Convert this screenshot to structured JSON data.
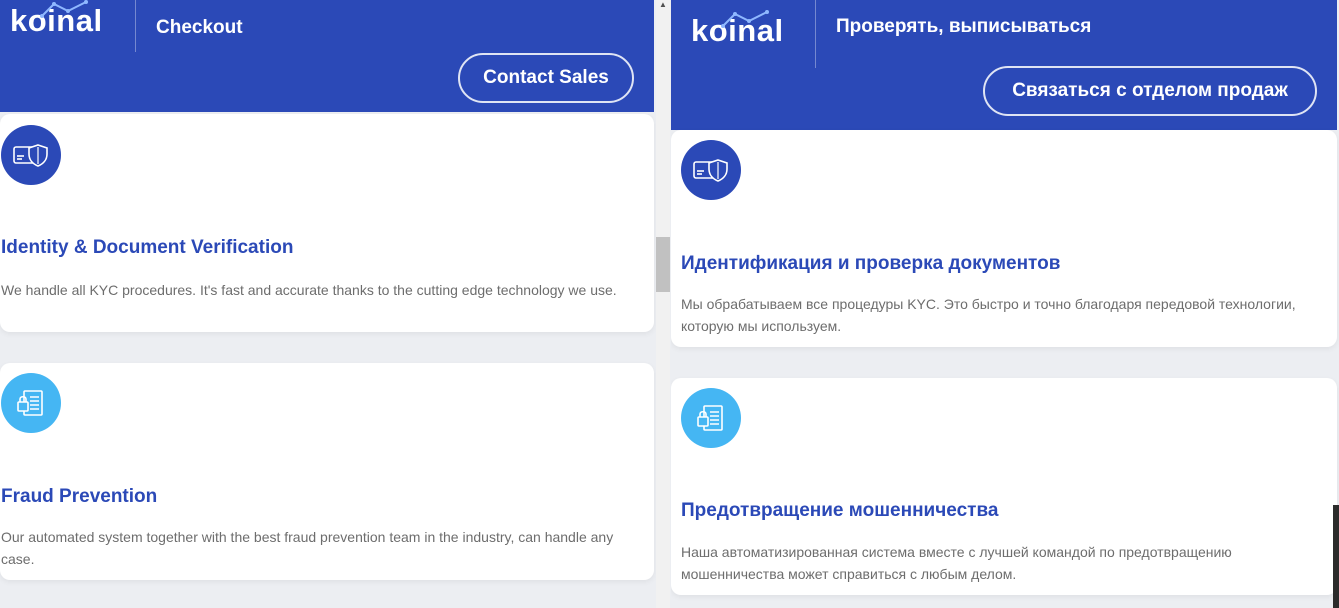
{
  "left": {
    "brand": "koinal",
    "title": "Checkout",
    "contact_button": "Contact Sales",
    "features": [
      {
        "icon": "id-card-shield-icon",
        "title": "Identity & Document Verification",
        "text": "We handle all KYC procedures. It's fast and accurate thanks to the cutting edge technology we use."
      },
      {
        "icon": "fraud-document-lock-icon",
        "title": "Fraud Prevention",
        "text": "Our automated system together with the best fraud prevention team in the industry, can handle any case."
      }
    ]
  },
  "right": {
    "brand": "koinal",
    "title": "Проверять, выписываться",
    "contact_button": "Связаться с отделом продаж",
    "features": [
      {
        "icon": "id-card-shield-icon",
        "title": "Идентификация и проверка документов",
        "text": "Мы обрабатываем все процедуры KYC. Это быстро и точно благодаря передовой технологии, которую мы используем."
      },
      {
        "icon": "fraud-document-lock-icon",
        "title": "Предотвращение мошенничества",
        "text": "Наша автоматизированная система вместе с лучшей командой по предотвращению мошенничества может справиться с любым делом."
      }
    ]
  },
  "colors": {
    "brand_blue": "#2b49b7",
    "accent_light_blue": "#45b6f3",
    "text_gray": "#6d6d6d",
    "background": "#eceef2"
  }
}
